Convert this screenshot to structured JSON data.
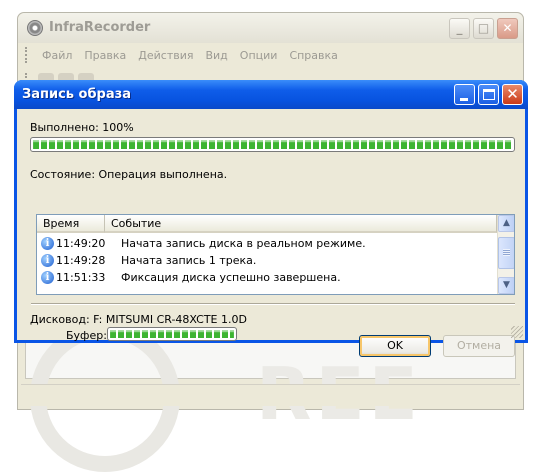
{
  "main_window": {
    "title": "InfraRecorder",
    "menu": [
      "Файл",
      "Правка",
      "Действия",
      "Вид",
      "Опции",
      "Справка"
    ]
  },
  "dialog": {
    "title": "Запись образа",
    "completed_label": "Выполнено: 100%",
    "progress_percent": 100,
    "status_label": "Состояние: Операция выполнена.",
    "log": {
      "columns": [
        "Время",
        "Событие"
      ],
      "rows": [
        {
          "time": "11:49:20",
          "event": "Начата запись диска в реальном режиме."
        },
        {
          "time": "11:49:28",
          "event": "Начата запись 1 трека."
        },
        {
          "time": "11:51:33",
          "event": "Фиксация диска успешно завершена."
        }
      ]
    },
    "drive_label": "Дисковод: F: MITSUMI CR-48XCTE 1.0D",
    "buffer_label": "Буфер:",
    "buffer_percent": 100,
    "ok_label": "OK",
    "cancel_label": "Отмена"
  },
  "colors": {
    "titlebar_active": "#0a55e6",
    "progress_green": "#3db432",
    "window_face": "#ece9d8"
  },
  "icons": [
    "app-disc-icon",
    "info-icon",
    "minimize-icon",
    "maximize-icon",
    "close-icon",
    "scroll-up-icon",
    "scroll-down-icon"
  ]
}
